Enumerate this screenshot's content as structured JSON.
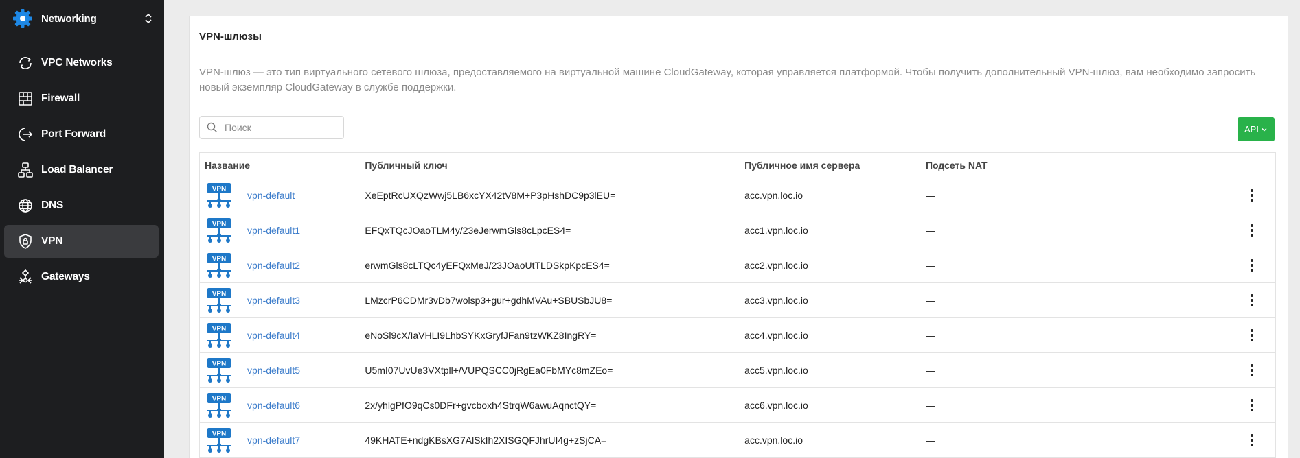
{
  "sidebar": {
    "app_name": "Networking",
    "items": [
      {
        "label": "VPC Networks",
        "icon": "vpc-icon",
        "active": false
      },
      {
        "label": "Firewall",
        "icon": "firewall-icon",
        "active": false
      },
      {
        "label": "Port Forward",
        "icon": "port-forward-icon",
        "active": false
      },
      {
        "label": "Load Balancer",
        "icon": "load-balancer-icon",
        "active": false
      },
      {
        "label": "DNS",
        "icon": "globe-icon",
        "active": false
      },
      {
        "label": "VPN",
        "icon": "shield-lock-icon",
        "active": true
      },
      {
        "label": "Gateways",
        "icon": "gateways-icon",
        "active": false
      }
    ]
  },
  "main": {
    "title": "VPN-шлюзы",
    "description": "VPN-шлюз — это тип виртуального сетевого шлюза, предоставляемого на виртуальной машине CloudGateway, которая управляется платформой. Чтобы получить дополнительный VPN-шлюз, вам необходимо запросить новый экземпляр CloudGateway в службе поддержки.",
    "search_placeholder": "Поиск",
    "api_label": "API",
    "columns": [
      "Название",
      "Публичный ключ",
      "Публичное имя сервера",
      "Подсеть NAT"
    ],
    "rows": [
      {
        "name": "vpn-default",
        "key": "XeEptRcUXQzWwj5LB6xcYX42tV8M+P3pHshDC9p3lEU=",
        "server": "acc.vpn.loc.io",
        "nat": "—"
      },
      {
        "name": "vpn-default1",
        "key": "EFQxTQcJOaoTLM4y/23eJerwmGls8cLpcES4=",
        "server": "acc1.vpn.loc.io",
        "nat": "—"
      },
      {
        "name": "vpn-default2",
        "key": "erwmGls8cLTQc4yEFQxMeJ/23JOaoUtTLDSkpKpcES4=",
        "server": "acc2.vpn.loc.io",
        "nat": "—"
      },
      {
        "name": "vpn-default3",
        "key": "LMzcrP6CDMr3vDb7wolsp3+gur+gdhMVAu+SBUSbJU8=",
        "server": "acc3.vpn.loc.io",
        "nat": "—"
      },
      {
        "name": "vpn-default4",
        "key": "eNoSl9cX/IaVHLI9LhbSYKxGryfJFan9tzWKZ8IngRY=",
        "server": "acc4.vpn.loc.io",
        "nat": "—"
      },
      {
        "name": "vpn-default5",
        "key": "U5mI07UvUe3VXtpll+/VUPQSCC0jRgEa0FbMYc8mZEo=",
        "server": "acc5.vpn.loc.io",
        "nat": "—"
      },
      {
        "name": "vpn-default6",
        "key": "2x/yhlgPfO9qCs0DFr+gvcboxh4StrqW6awuAqnctQY=",
        "server": "acc6.vpn.loc.io",
        "nat": "—"
      },
      {
        "name": "vpn-default7",
        "key": "49KHATE+ndgKBsXG7AlSkIh2XISGQFJhrUI4g+zSjCA=",
        "server": "acc.vpn.loc.io",
        "nat": "—"
      }
    ]
  },
  "colors": {
    "sidebar_bg": "#1d1e20",
    "active_item_bg": "#3a3b3e",
    "link": "#3d7dcb",
    "api_button": "#29b24a",
    "vpn_icon": "#1e78c8"
  }
}
